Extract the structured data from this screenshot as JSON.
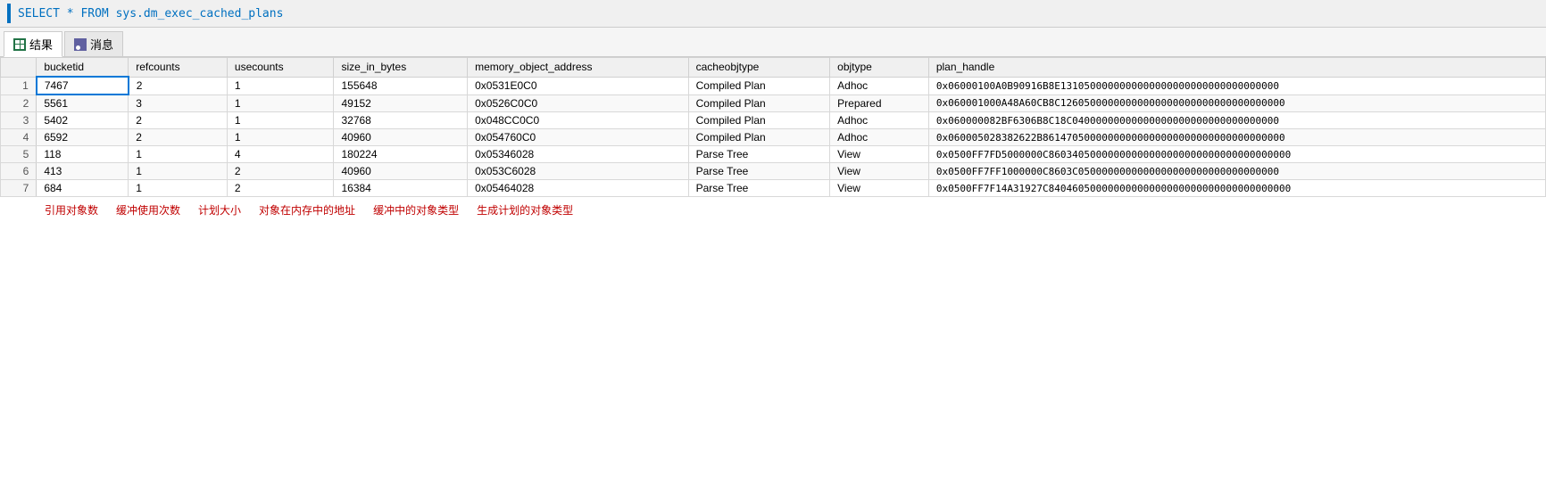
{
  "sql_bar": {
    "code": "SELECT * FROM sys.dm_exec_cached_plans"
  },
  "tabs": [
    {
      "id": "results",
      "label": "结果",
      "active": true
    },
    {
      "id": "messages",
      "label": "消息",
      "active": false
    }
  ],
  "table": {
    "columns": [
      "bucketid",
      "refcounts",
      "usecounts",
      "size_in_bytes",
      "memory_object_address",
      "cacheobjtype",
      "objtype",
      "plan_handle"
    ],
    "rows": [
      {
        "num": "1",
        "bucketid": "7467",
        "refcounts": "2",
        "usecounts": "1",
        "size_in_bytes": "155648",
        "memory_object_address": "0x0531E0C0",
        "cacheobjtype": "Compiled Plan",
        "objtype": "Adhoc",
        "plan_handle": "0x06000100A0B90916B8E1310500000000000000000000000000000000",
        "selected": true
      },
      {
        "num": "2",
        "bucketid": "5561",
        "refcounts": "3",
        "usecounts": "1",
        "size_in_bytes": "49152",
        "memory_object_address": "0x0526C0C0",
        "cacheobjtype": "Compiled Plan",
        "objtype": "Prepared",
        "plan_handle": "0x060001000A48A60CB8C12605000000000000000000000000000000000",
        "selected": false
      },
      {
        "num": "3",
        "bucketid": "5402",
        "refcounts": "2",
        "usecounts": "1",
        "size_in_bytes": "32768",
        "memory_object_address": "0x048CC0C0",
        "cacheobjtype": "Compiled Plan",
        "objtype": "Adhoc",
        "plan_handle": "0x060000082BF6306B8C18C04000000000000000000000000000000000",
        "selected": false
      },
      {
        "num": "4",
        "bucketid": "6592",
        "refcounts": "2",
        "usecounts": "1",
        "size_in_bytes": "40960",
        "memory_object_address": "0x054760C0",
        "cacheobjtype": "Compiled Plan",
        "objtype": "Adhoc",
        "plan_handle": "0x060005028382622B86147050000000000000000000000000000000000",
        "selected": false
      },
      {
        "num": "5",
        "bucketid": "118",
        "refcounts": "1",
        "usecounts": "4",
        "size_in_bytes": "180224",
        "memory_object_address": "0x05346028",
        "cacheobjtype": "Parse Tree",
        "objtype": "View",
        "plan_handle": "0x0500FF7FD5000000C86034050000000000000000000000000000000000",
        "selected": false
      },
      {
        "num": "6",
        "bucketid": "413",
        "refcounts": "1",
        "usecounts": "2",
        "size_in_bytes": "40960",
        "memory_object_address": "0x053C6028",
        "cacheobjtype": "Parse Tree",
        "objtype": "View",
        "plan_handle": "0x0500FF7FF1000000C8603C0500000000000000000000000000000000",
        "selected": false
      },
      {
        "num": "7",
        "bucketid": "684",
        "refcounts": "1",
        "usecounts": "2",
        "size_in_bytes": "16384",
        "memory_object_address": "0x05464028",
        "cacheobjtype": "Parse Tree",
        "objtype": "View",
        "plan_handle": "0x0500FF7F14A31927C84046050000000000000000000000000000000000",
        "selected": false
      }
    ]
  },
  "annotations": [
    "引用对象数",
    "缓冲使用次数",
    "计划大小",
    "对象在内存中的地址",
    "缓冲中的对象类型",
    "生成计划的对象类型"
  ]
}
